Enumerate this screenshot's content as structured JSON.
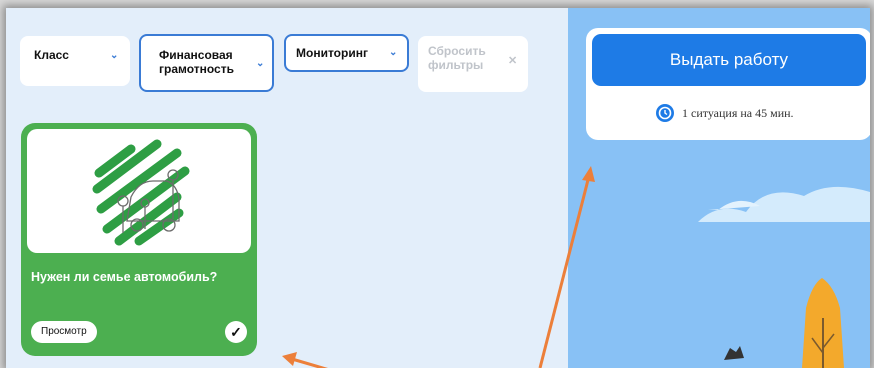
{
  "filters": {
    "class_label": "Класс",
    "financial_line1": "Финансовая",
    "financial_line2": "грамотность",
    "monitoring_label": "Мониторинг",
    "reset_line1": "Сбросить",
    "reset_line2": "фильтры"
  },
  "card": {
    "title": "Нужен ли семье автомобиль?",
    "view_label": "Просмотр",
    "check_symbol": "✓",
    "accent_color": "#4caf50"
  },
  "assign": {
    "button_label": "Выдать работу",
    "duration_text": "1 ситуация на 45 мин.",
    "button_color": "#1e7be6"
  },
  "icons": {
    "chevron": "chevron-down-icon",
    "close": "close-icon",
    "clock": "clock-icon",
    "check": "check-icon"
  },
  "annotation_color": "#ec7f3a"
}
